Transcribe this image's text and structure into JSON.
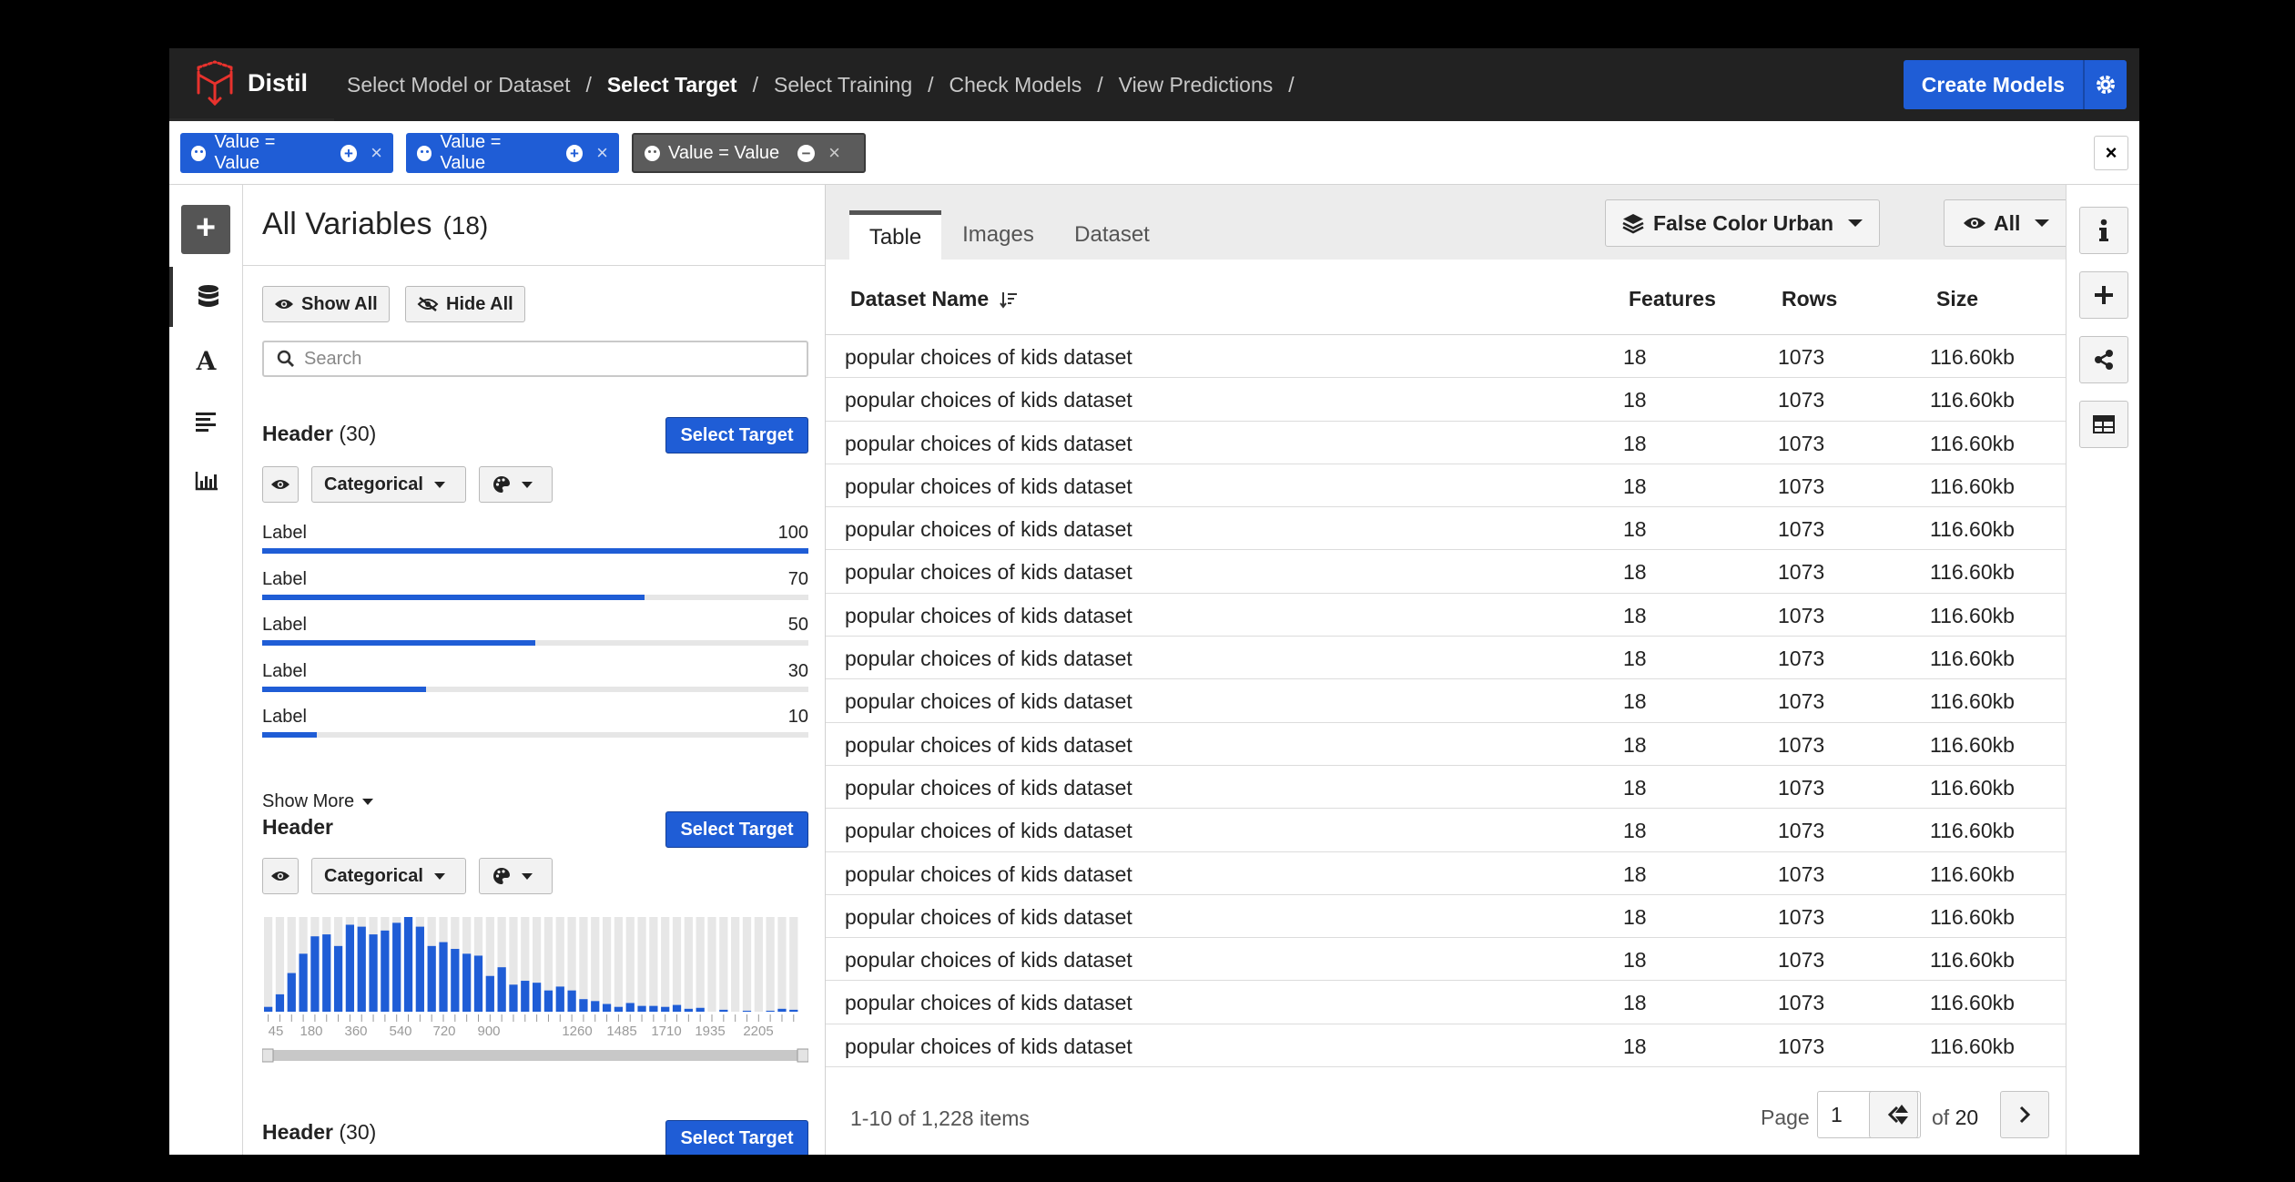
{
  "app": {
    "name": "Distil"
  },
  "breadcrumb": [
    {
      "label": "Select Model or Dataset",
      "active": false
    },
    {
      "label": "Select Target",
      "active": true
    },
    {
      "label": "Select Training",
      "active": false
    },
    {
      "label": "Check Models",
      "active": false
    },
    {
      "label": "View Predictions",
      "active": false
    }
  ],
  "breadcrumb_sep": "/",
  "toolbar": {
    "create_models": "Create Models"
  },
  "filters": [
    {
      "label": "Value = Value",
      "style": "blue",
      "action_glyph": "+"
    },
    {
      "label": "Value = Value",
      "style": "blue",
      "action_glyph": "+"
    },
    {
      "label": "Value = Value",
      "style": "grey",
      "action_glyph": "−"
    }
  ],
  "filter_close": "×",
  "variables": {
    "title": "All Variables",
    "count": "(18)",
    "show_all": "Show All",
    "hide_all": "Hide All",
    "search_placeholder": "Search",
    "select_target": "Select Target",
    "type_label": "Categorical",
    "show_more": "Show More",
    "groups": [
      {
        "title": "Header",
        "count": "(30)"
      },
      {
        "title": "Header",
        "count": ""
      },
      {
        "title": "Header",
        "count": "(30)"
      }
    ],
    "facets": [
      {
        "label": "Label",
        "value": 100,
        "display": "100"
      },
      {
        "label": "Label",
        "value": 70,
        "display": "70"
      },
      {
        "label": "Label",
        "value": 50,
        "display": "50"
      },
      {
        "label": "Label",
        "value": 30,
        "display": "30"
      },
      {
        "label": "Label",
        "value": 10,
        "display": "10"
      }
    ],
    "histogram": {
      "tick_labels": [
        "45",
        "180",
        "360",
        "540",
        "720",
        "900",
        "1260",
        "1485",
        "1710",
        "1935",
        "2205"
      ],
      "bar_values": [
        5,
        18,
        40,
        60,
        78,
        80,
        68,
        90,
        88,
        80,
        84,
        92,
        98,
        88,
        68,
        72,
        65,
        60,
        58,
        37,
        46,
        28,
        32,
        30,
        22,
        26,
        22,
        13,
        11,
        8,
        5,
        9,
        6,
        6,
        5,
        7,
        3,
        4,
        0,
        2,
        0,
        1,
        0,
        1,
        3,
        2
      ]
    }
  },
  "main": {
    "tabs": [
      {
        "label": "Table",
        "active": true
      },
      {
        "label": "Images",
        "active": false
      },
      {
        "label": "Dataset",
        "active": false
      }
    ],
    "layer_dropdown": "False Color Urban",
    "view_dropdown": "All",
    "columns": {
      "name": "Dataset Name",
      "features": "Features",
      "rows": "Rows",
      "size": "Size"
    },
    "rows": [
      {
        "name": "popular choices of kids dataset",
        "features": "18",
        "rows": "1073",
        "size": "116.60kb"
      },
      {
        "name": "popular choices of kids dataset",
        "features": "18",
        "rows": "1073",
        "size": "116.60kb"
      },
      {
        "name": "popular choices of kids dataset",
        "features": "18",
        "rows": "1073",
        "size": "116.60kb"
      },
      {
        "name": "popular choices of kids dataset",
        "features": "18",
        "rows": "1073",
        "size": "116.60kb"
      },
      {
        "name": "popular choices of kids dataset",
        "features": "18",
        "rows": "1073",
        "size": "116.60kb"
      },
      {
        "name": "popular choices of kids dataset",
        "features": "18",
        "rows": "1073",
        "size": "116.60kb"
      },
      {
        "name": "popular choices of kids dataset",
        "features": "18",
        "rows": "1073",
        "size": "116.60kb"
      },
      {
        "name": "popular choices of kids dataset",
        "features": "18",
        "rows": "1073",
        "size": "116.60kb"
      },
      {
        "name": "popular choices of kids dataset",
        "features": "18",
        "rows": "1073",
        "size": "116.60kb"
      },
      {
        "name": "popular choices of kids dataset",
        "features": "18",
        "rows": "1073",
        "size": "116.60kb"
      },
      {
        "name": "popular choices of kids dataset",
        "features": "18",
        "rows": "1073",
        "size": "116.60kb"
      },
      {
        "name": "popular choices of kids dataset",
        "features": "18",
        "rows": "1073",
        "size": "116.60kb"
      },
      {
        "name": "popular choices of kids dataset",
        "features": "18",
        "rows": "1073",
        "size": "116.60kb"
      },
      {
        "name": "popular choices of kids dataset",
        "features": "18",
        "rows": "1073",
        "size": "116.60kb"
      },
      {
        "name": "popular choices of kids dataset",
        "features": "18",
        "rows": "1073",
        "size": "116.60kb"
      },
      {
        "name": "popular choices of kids dataset",
        "features": "18",
        "rows": "1073",
        "size": "116.60kb"
      },
      {
        "name": "popular choices of kids dataset",
        "features": "18",
        "rows": "1073",
        "size": "116.60kb"
      }
    ],
    "pager": {
      "info": "1-10 of 1,228 items",
      "page_word": "Page",
      "page": "1",
      "of_word": "of",
      "total": "20"
    }
  },
  "colors": {
    "accent": "#1f5dd6",
    "topbar": "#222222",
    "logo_red": "#e8322d"
  },
  "icons": {
    "rail": [
      "database-icon",
      "text-icon",
      "align-left-icon",
      "bar-chart-icon"
    ],
    "right_rail": [
      "info-icon",
      "plus-icon",
      "share-icon",
      "table-icon"
    ]
  }
}
